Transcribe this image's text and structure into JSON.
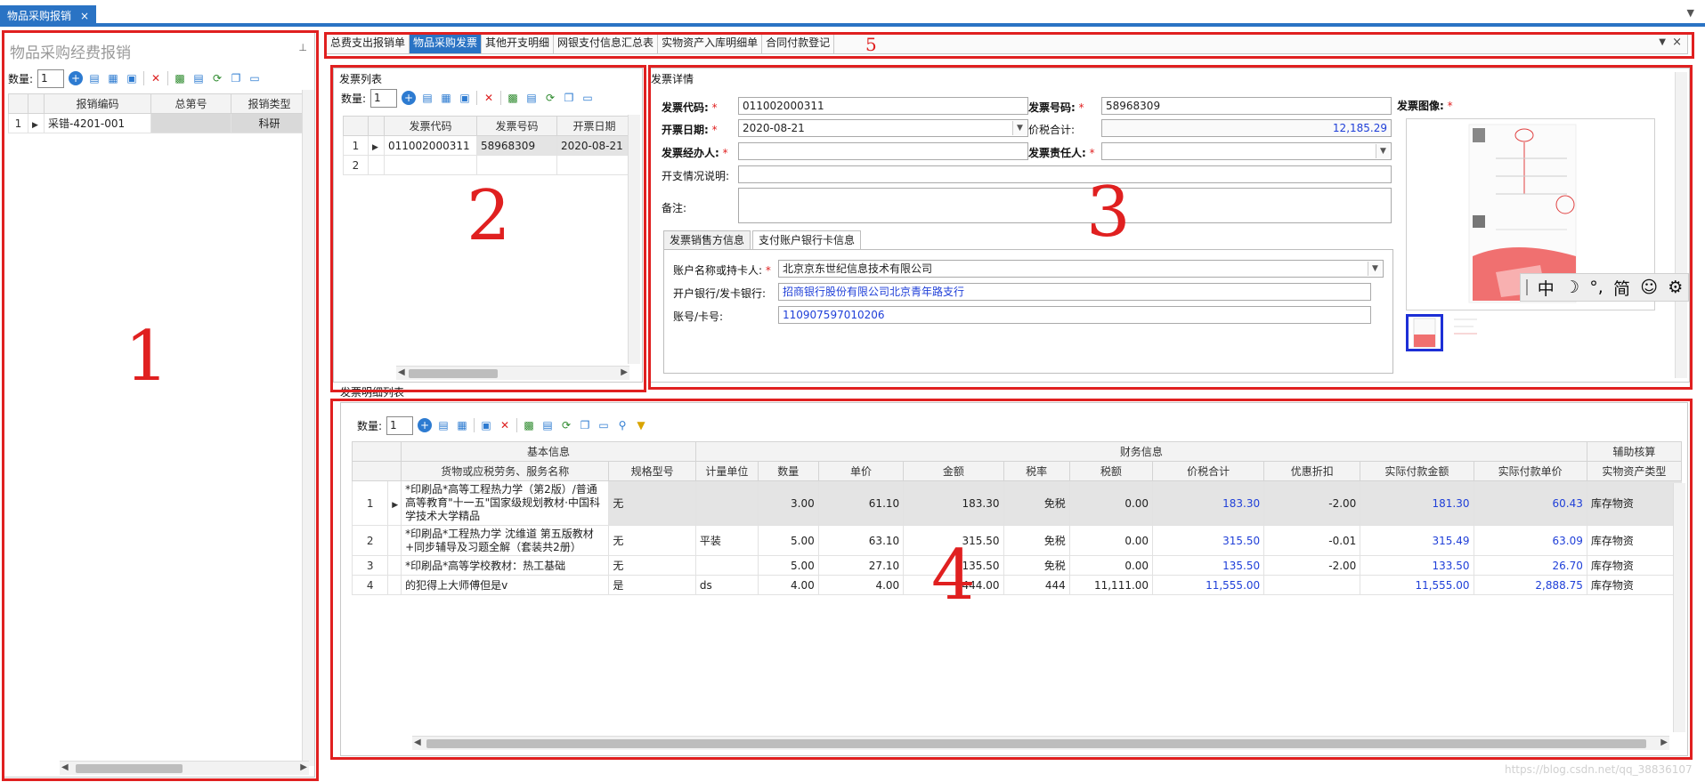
{
  "window": {
    "doc_tab_label": "物品采购报销",
    "close_glyph": "×"
  },
  "left_panel": {
    "title": "物品采购经费报销",
    "pin_glyph": "ᵖ",
    "qty_label": "数量:",
    "qty_value": "1",
    "columns": [
      "报销编码",
      "总第号",
      "报销类型"
    ],
    "rows": [
      {
        "idx": "1",
        "code": "采错-4201-001",
        "serial": "",
        "type": "科研"
      }
    ]
  },
  "top_tabs": {
    "items": [
      "总费支出报销单",
      "物品采购发票",
      "其他开支明细",
      "网银支付信息汇总表",
      "实物资产入库明细单",
      "合同付款登记"
    ],
    "active_index": 1
  },
  "invoice_list": {
    "title": "发票列表",
    "qty_label": "数量:",
    "qty_value": "1",
    "columns": [
      "发票代码",
      "发票号码",
      "开票日期"
    ],
    "rows": [
      {
        "idx": "1",
        "code": "011002000311",
        "number": "58968309",
        "date": "2020-08-21"
      },
      {
        "idx": "2",
        "code": "",
        "number": "",
        "date": ""
      }
    ]
  },
  "invoice_detail": {
    "title": "发票详情",
    "code_label": "发票代码:",
    "code_value": "011002000311",
    "number_label": "发票号码:",
    "number_value": "58968309",
    "date_label": "开票日期:",
    "date_value": "2020-08-21",
    "total_label": "价税合计:",
    "total_value": "12,185.29",
    "handler_label": "发票经办人:",
    "handler_value": "",
    "owner_label": "发票责任人:",
    "owner_value": "",
    "desc_label": "开支情况说明:",
    "desc_value": "",
    "note_label": "备注:",
    "note_value": "",
    "image_label": "发票图像:",
    "subtabs": [
      "发票销售方信息",
      "支付账户银行卡信息"
    ],
    "active_subtab": 1,
    "account_label": "账户名称或持卡人:",
    "account_value": "北京京东世纪信息技术有限公司",
    "bank_label": "开户银行/发卡银行:",
    "bank_value": "招商银行股份有限公司北京青年路支行",
    "card_label": "账号/卡号:",
    "card_value": "110907597010206"
  },
  "ime_bar": {
    "items": [
      "中",
      "☽",
      "°,",
      "简",
      "☺",
      "⚙"
    ]
  },
  "detail_list": {
    "title": "发票明细列表",
    "qty_label": "数量:",
    "qty_value": "1",
    "group_headers": [
      "基本信息",
      "财务信息",
      "辅助核算"
    ],
    "columns": [
      "货物或应税劳务、服务名称",
      "规格型号",
      "计量单位",
      "数量",
      "单价",
      "金额",
      "税率",
      "税额",
      "价税合计",
      "优惠折扣",
      "实际付款金额",
      "实际付款单价",
      "实物资产类型"
    ],
    "rows": [
      {
        "idx": "1",
        "name": "*印刷品*高等工程热力学（第2版）/普通高等教育\"十一五\"国家级规划教材·中国科学技术大学精品",
        "spec": "无",
        "unit": "",
        "qty": "3.00",
        "price": "61.10",
        "amount": "183.30",
        "rate": "免税",
        "tax": "0.00",
        "total": "183.30",
        "discount": "-2.00",
        "paid": "181.30",
        "paid_unit": "60.43",
        "asset_type": "库存物资"
      },
      {
        "idx": "2",
        "name": "*印刷品*工程热力学 沈维道 第五版教材+同步辅导及习题全解（套装共2册）",
        "spec": "无",
        "unit": "平装",
        "qty": "5.00",
        "price": "63.10",
        "amount": "315.50",
        "rate": "免税",
        "tax": "0.00",
        "total": "315.50",
        "discount": "-0.01",
        "paid": "315.49",
        "paid_unit": "63.09",
        "asset_type": "库存物资"
      },
      {
        "idx": "3",
        "name": "*印刷品*高等学校教材：热工基础",
        "spec": "无",
        "unit": "",
        "qty": "5.00",
        "price": "27.10",
        "amount": "135.50",
        "rate": "免税",
        "tax": "0.00",
        "total": "135.50",
        "discount": "-2.00",
        "paid": "133.50",
        "paid_unit": "26.70",
        "asset_type": "库存物资"
      },
      {
        "idx": "4",
        "name": "的犯得上大师傅但是v",
        "spec": "是",
        "unit": "ds",
        "qty": "4.00",
        "price": "4.00",
        "amount": "444.00",
        "rate": "444",
        "tax": "11,111.00",
        "total": "11,555.00",
        "discount": "",
        "paid": "11,555.00",
        "paid_unit": "2,888.75",
        "asset_type": "库存物资"
      }
    ]
  },
  "annotations": {
    "labels": [
      "1",
      "2",
      "3",
      "4",
      "5"
    ],
    "color": "#e02020"
  },
  "watermark": "https://blog.csdn.net/qq_38836107",
  "colors": {
    "accent": "#2a73c4",
    "value_blue": "#1f3fd8",
    "annotation_red": "#e02020"
  }
}
